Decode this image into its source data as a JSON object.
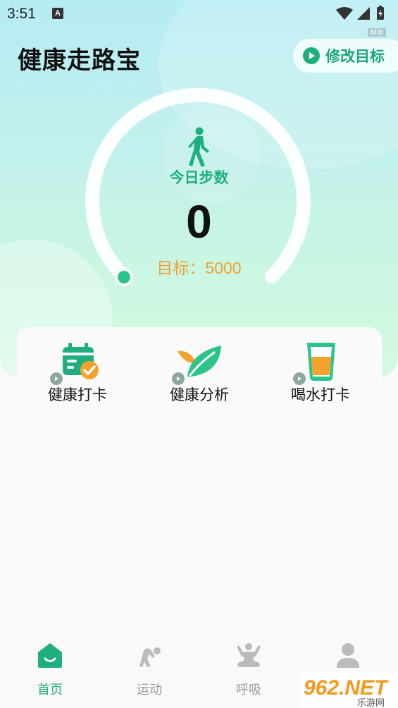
{
  "status_bar": {
    "time": "3:51",
    "a_badge": "A"
  },
  "watermark_tag": "bl3r",
  "header": {
    "title": "健康走路宝",
    "modify_goal_label": "修改目标"
  },
  "pedometer": {
    "today_label": "今日步数",
    "steps": "0",
    "goal_text": "目标：5000",
    "progress_fraction": 0.0
  },
  "features": [
    {
      "label": "健康打卡",
      "icon": "calendar-check-icon"
    },
    {
      "label": "健康分析",
      "icon": "leaf-icon"
    },
    {
      "label": "喝水打卡",
      "icon": "water-cup-icon"
    }
  ],
  "tabs": [
    {
      "label": "首页",
      "icon": "home-icon",
      "active": true
    },
    {
      "label": "运动",
      "icon": "exercise-icon",
      "active": false
    },
    {
      "label": "呼吸",
      "icon": "meditation-icon",
      "active": false
    },
    {
      "label": "",
      "icon": "profile-icon",
      "active": false
    }
  ],
  "site_watermark": {
    "text": "962.NET",
    "subtext": "乐游网"
  },
  "colors": {
    "accent": "#1fae7e",
    "goal": "#eea339",
    "text": "#111111",
    "inactive": "#999999"
  }
}
